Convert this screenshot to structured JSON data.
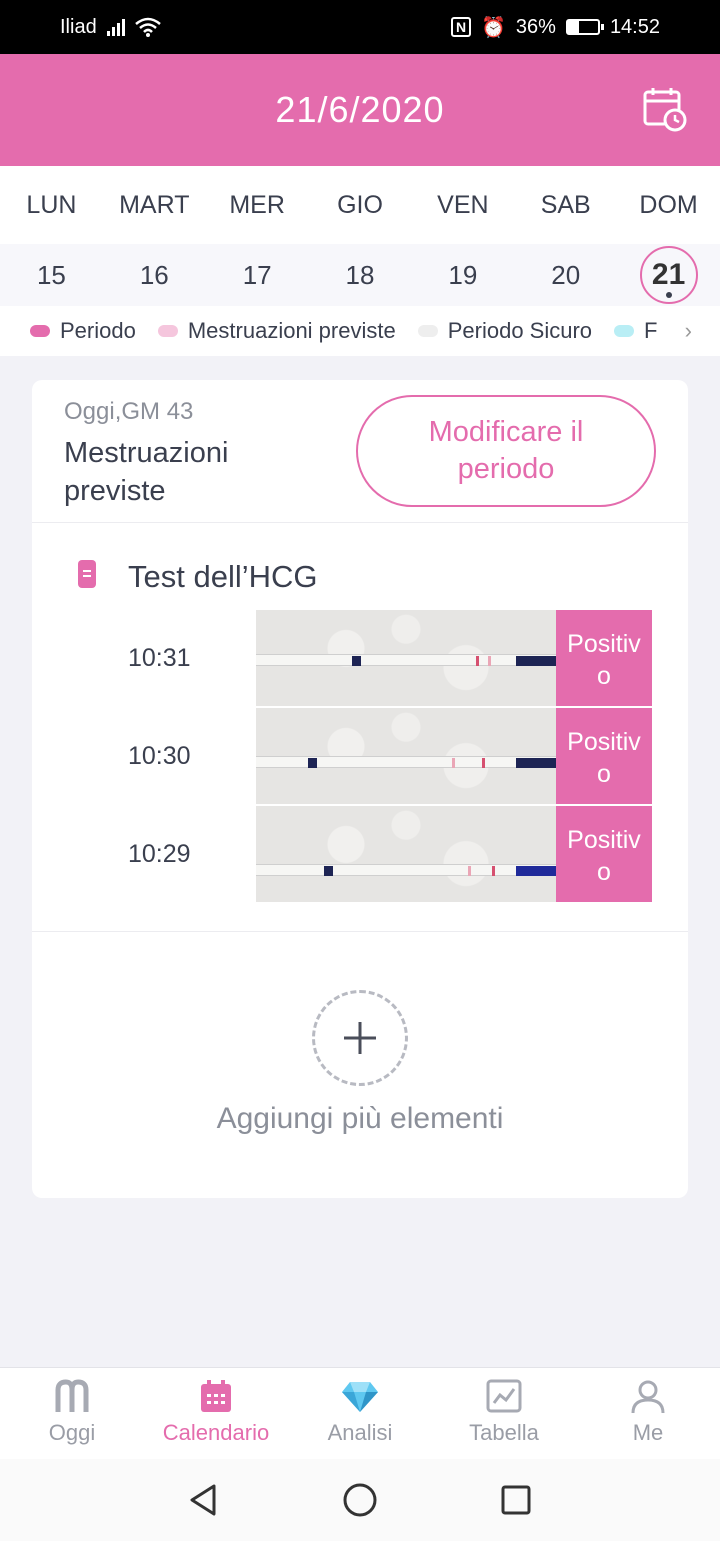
{
  "status_bar": {
    "carrier": "Iliad",
    "battery": "36%",
    "time": "14:52",
    "battery_level": 0.36
  },
  "header": {
    "title": "21/6/2020",
    "icon": "calendar-clock-icon"
  },
  "week": {
    "days": [
      "LUN",
      "MART",
      "MER",
      "GIO",
      "VEN",
      "SAB",
      "DOM"
    ],
    "dates": [
      "15",
      "16",
      "17",
      "18",
      "19",
      "20",
      "21"
    ],
    "selected_date": "21"
  },
  "legend": {
    "items": [
      {
        "label": "Periodo",
        "color": "#e46cad"
      },
      {
        "label": "Mestruazioni previste",
        "color": "#f5c6dd"
      },
      {
        "label": "Periodo Sicuro",
        "color": "#eeeeee"
      },
      {
        "label": "F",
        "color": "#b9eef5"
      }
    ]
  },
  "card": {
    "day_label": "Oggi,GM 43",
    "status": "Mestruazioni previste",
    "edit_button": "Modificare il periodo",
    "section_title": "Test dell’HCG",
    "tests": [
      {
        "time": "10:31",
        "result": "Positivo"
      },
      {
        "time": "10:30",
        "result": "Positivo"
      },
      {
        "time": "10:29",
        "result": "Positivo"
      }
    ],
    "add_label": "Aggiungi più elementi"
  },
  "bottom_nav": {
    "items": [
      {
        "label": "Oggi",
        "icon": "today-icon",
        "active": false
      },
      {
        "label": "Calendario",
        "icon": "calendar-icon",
        "active": true
      },
      {
        "label": "Analisi",
        "icon": "diamond-icon",
        "active": false
      },
      {
        "label": "Tabella",
        "icon": "chart-icon",
        "active": false
      },
      {
        "label": "Me",
        "icon": "person-icon",
        "active": false
      }
    ]
  },
  "colors": {
    "accent": "#e46cad",
    "text": "#3a3f4e",
    "muted": "#8b8f99"
  }
}
